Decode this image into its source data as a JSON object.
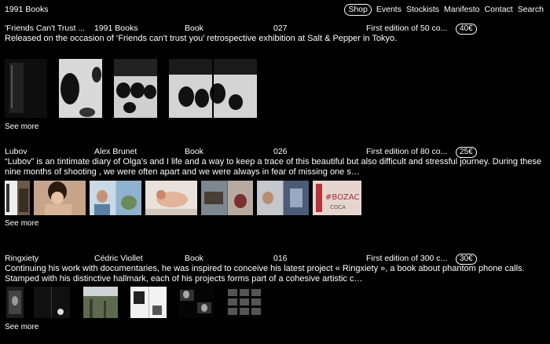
{
  "site": {
    "title": "1991 Books"
  },
  "nav": [
    {
      "label": "Shop",
      "active": true
    },
    {
      "label": "Events"
    },
    {
      "label": "Stockists"
    },
    {
      "label": "Manifesto"
    },
    {
      "label": "Contact"
    },
    {
      "label": "Search"
    }
  ],
  "products": [
    {
      "title": "'Friends Can't Trust ...",
      "author": "1991 Books",
      "type": "Book",
      "number": "027",
      "edition": "First edition of 50 co...",
      "price": "40€",
      "description": "Released on the occasion of ‘Friends can't trust you’ retrospective exhibition at Salt & Pepper in Tokyo.",
      "see_more": "See more"
    },
    {
      "title": "Lubov",
      "author": "Alex Brunet",
      "type": "Book",
      "number": "026",
      "edition": "First edition of 80 co...",
      "price": "25€",
      "description": "“Lubov” is an tintimate diary of Olga’s and I life and a way to keep a trace of this beautiful but also difficult and stressful journey. During these nine months of shooting , we were often apart and we were always in fear of missing one s…",
      "see_more": "See more"
    },
    {
      "title": "Ringxiety",
      "author": "Cédric Viollet",
      "type": "Book",
      "number": "016",
      "edition": "First edition of 300 c...",
      "price": "30€",
      "description": "Continuing his work with documentaries, he was inspired to conceive his latest project « Ringxiety », a book about phantom phone calls. Stamped with his distinctive hallmark, each of his projects forms part of a cohesive artistic c…",
      "see_more": "See more"
    }
  ]
}
